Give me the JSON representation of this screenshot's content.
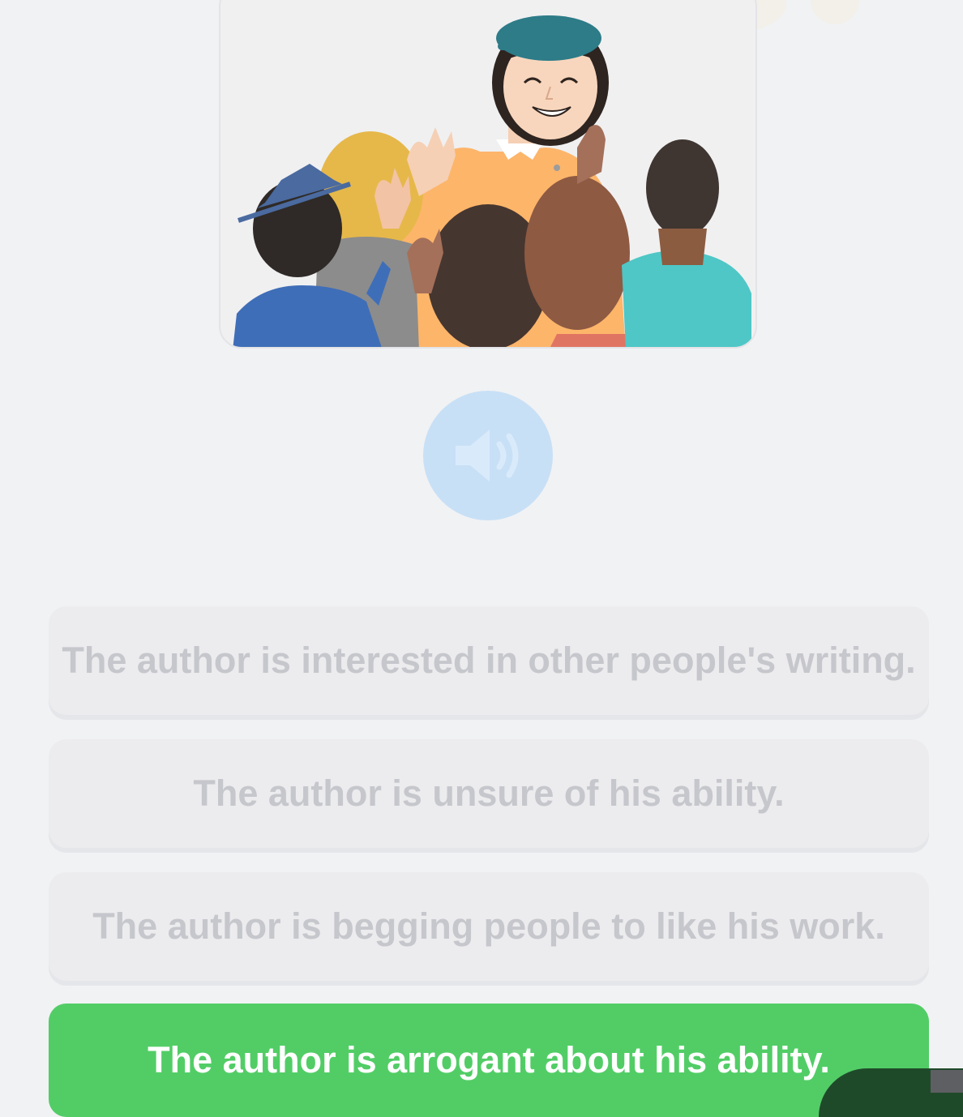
{
  "illustration": {
    "icon": "people-waving-crowd-illustration"
  },
  "audio": {
    "icon": "speaker-icon"
  },
  "options": [
    {
      "label": "The author is interested in other people's writing.",
      "state": "faded"
    },
    {
      "label": "The author is unsure of his ability.",
      "state": "faded"
    },
    {
      "label": "The author is begging people to like his work.",
      "state": "faded"
    },
    {
      "label": "The author is arrogant about his ability.",
      "state": "correct"
    }
  ],
  "colors": {
    "background": "#f1f2f4",
    "correct": "#52cd66",
    "audio_button": "#c8e0f6",
    "faded_text": "#c6c7cc"
  }
}
